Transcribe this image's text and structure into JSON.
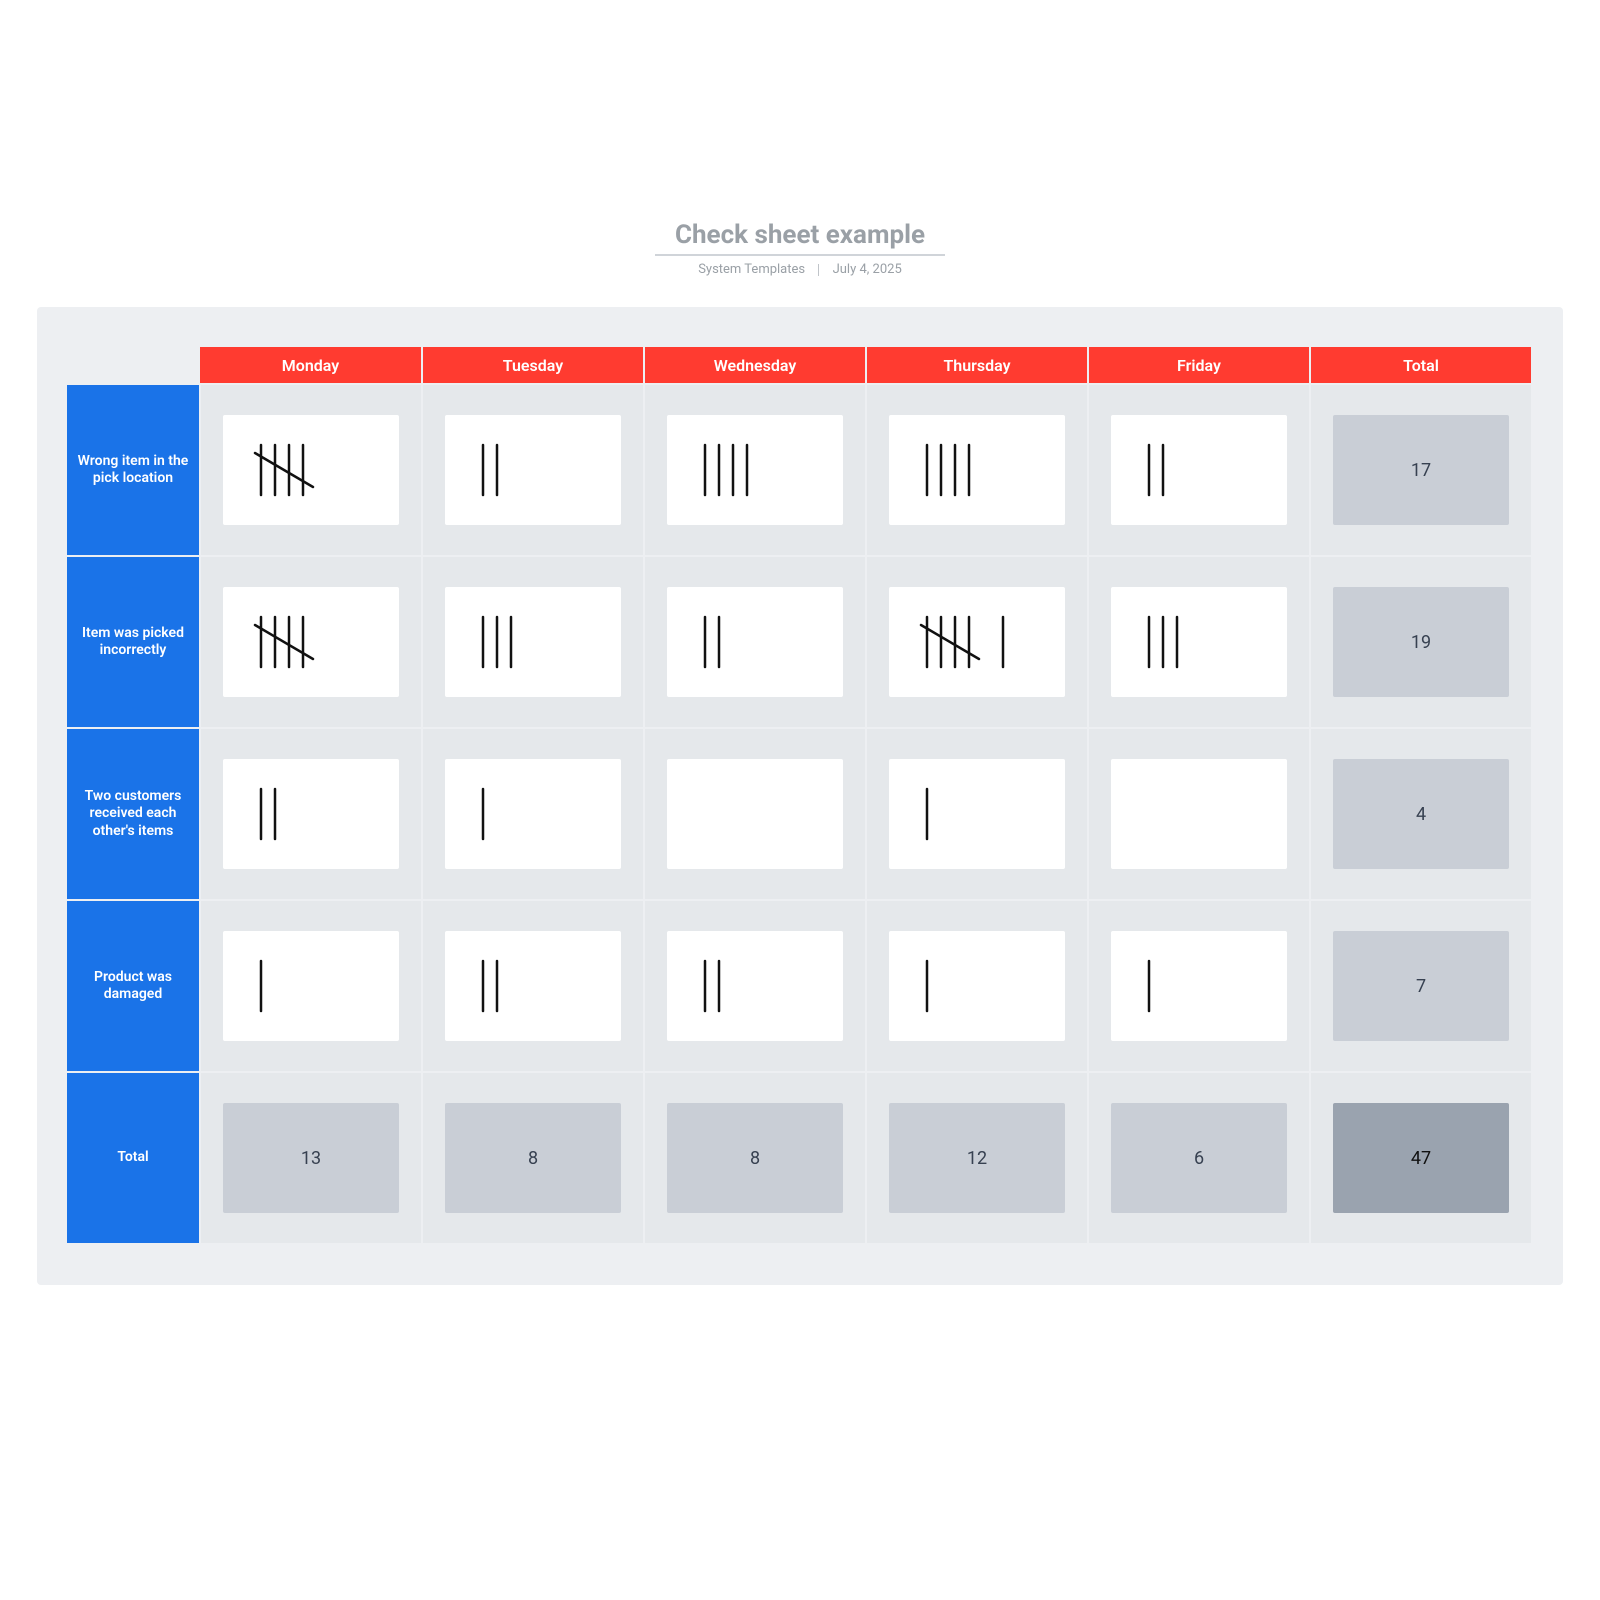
{
  "title": "Check sheet example",
  "author": "System Templates",
  "date": "July 4, 2025",
  "columns": [
    "Monday",
    "Tuesday",
    "Wednesday",
    "Thursday",
    "Friday",
    "Total"
  ],
  "rows": [
    {
      "label": "Wrong item in the pick location",
      "tallies": [
        5,
        2,
        4,
        4,
        2
      ],
      "total": 17
    },
    {
      "label": "Item was picked incorrectly",
      "tallies": [
        5,
        3,
        2,
        6,
        3
      ],
      "total": 19
    },
    {
      "label": "Two customers received each other's items",
      "tallies": [
        2,
        1,
        0,
        1,
        0
      ],
      "total": 4
    },
    {
      "label": "Product was damaged",
      "tallies": [
        1,
        2,
        2,
        1,
        1
      ],
      "total": 7
    }
  ],
  "footer": {
    "label": "Total",
    "values": [
      13,
      8,
      8,
      12,
      6
    ],
    "grand": 47
  },
  "chart_data": {
    "type": "table",
    "title": "Check sheet example",
    "columns": [
      "Monday",
      "Tuesday",
      "Wednesday",
      "Thursday",
      "Friday",
      "Total"
    ],
    "rows": [
      {
        "category": "Wrong item in the pick location",
        "values": [
          5,
          2,
          4,
          4,
          2
        ],
        "total": 17
      },
      {
        "category": "Item was picked incorrectly",
        "values": [
          5,
          3,
          2,
          6,
          3
        ],
        "total": 19
      },
      {
        "category": "Two customers received each other's items",
        "values": [
          2,
          1,
          0,
          1,
          0
        ],
        "total": 4
      },
      {
        "category": "Product was damaged",
        "values": [
          1,
          2,
          2,
          1,
          1
        ],
        "total": 7
      }
    ],
    "column_totals": [
      13,
      8,
      8,
      12,
      6
    ],
    "grand_total": 47
  }
}
